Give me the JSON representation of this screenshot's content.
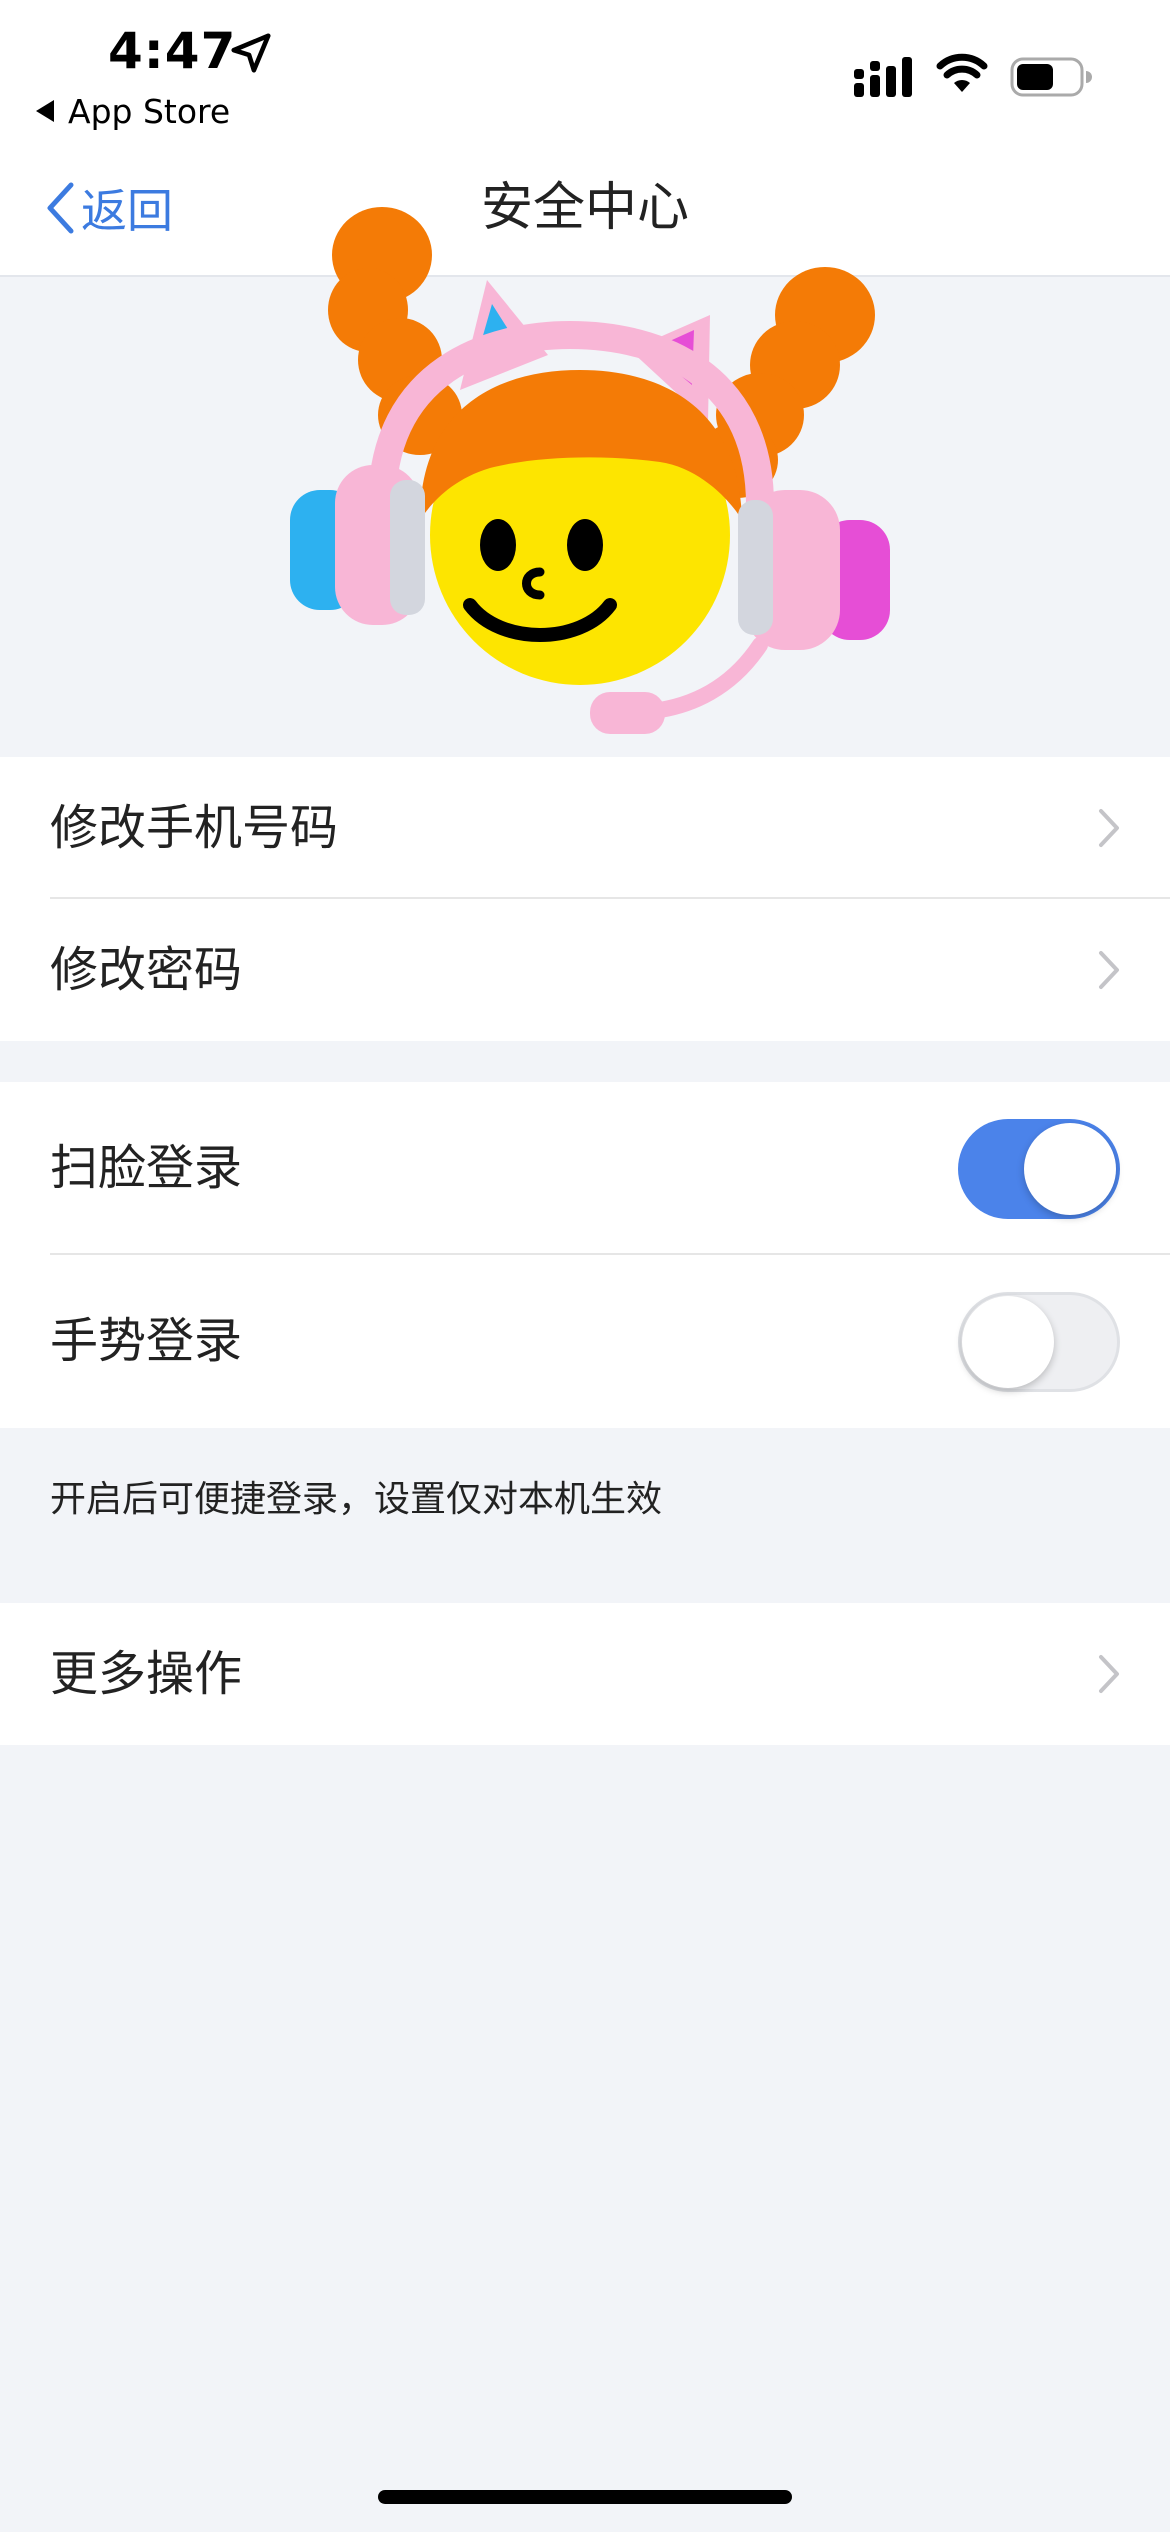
{
  "status_bar": {
    "time": "4:47",
    "back_app": "App Store"
  },
  "nav": {
    "back_label": "返回",
    "title": "安全中心"
  },
  "groups": [
    {
      "rows": [
        {
          "label": "修改手机号码",
          "accessory": "chevron"
        },
        {
          "label": "修改密码",
          "accessory": "chevron"
        }
      ]
    },
    {
      "rows": [
        {
          "label": "扫脸登录",
          "accessory": "toggle",
          "on": true
        },
        {
          "label": "手势登录",
          "accessory": "toggle",
          "on": false
        }
      ]
    },
    {
      "rows": [
        {
          "label": "更多操作",
          "accessory": "chevron"
        }
      ]
    }
  ],
  "hint": "开启后可便捷登录，设置仅对本机生效",
  "colors": {
    "accent": "#4b83ea",
    "background": "#f2f4f8",
    "toggle_off": "#eeeff2"
  }
}
